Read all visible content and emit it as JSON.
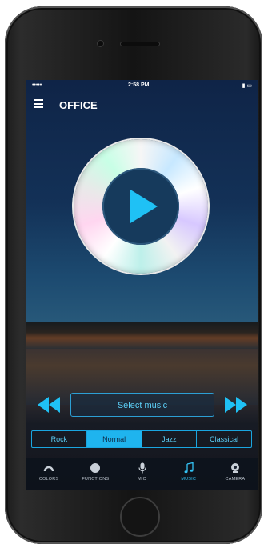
{
  "status_bar": {
    "signal": "•••••",
    "time": "2:58 PM",
    "battery": "▮ ▭"
  },
  "header": {
    "title": "OFFICE"
  },
  "player": {
    "select_music_label": "Select music"
  },
  "genres": [
    {
      "label": "Rock"
    },
    {
      "label": "Normal"
    },
    {
      "label": "Jazz"
    },
    {
      "label": "Classical"
    }
  ],
  "selected_genre": "Normal",
  "tabs": [
    {
      "label": "COLORS",
      "icon": "colors-icon"
    },
    {
      "label": "FUNCTIONS",
      "icon": "functions-icon"
    },
    {
      "label": "MIC",
      "icon": "mic-icon"
    },
    {
      "label": "MUSIC",
      "icon": "music-icon"
    },
    {
      "label": "CAMERA",
      "icon": "camera-icon"
    }
  ],
  "active_tab": "MUSIC",
  "colors": {
    "accent": "#1fb4ee",
    "accent_text": "#5ccff7",
    "sky_top": "#0f2447"
  }
}
